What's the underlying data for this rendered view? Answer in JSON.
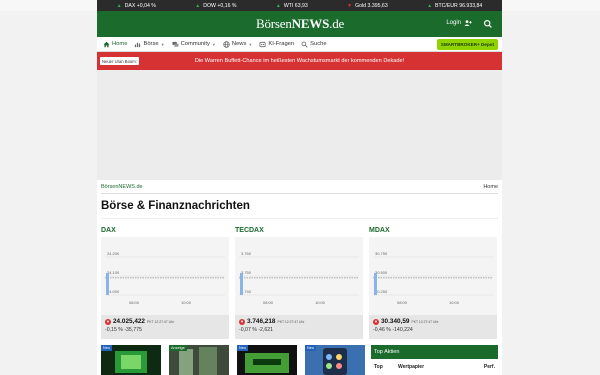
{
  "ticker": [
    {
      "label": "DAX +0,04 %",
      "dir": "up"
    },
    {
      "label": "DOW +0,16 %",
      "dir": "up"
    },
    {
      "label": "WTI 63,93",
      "dir": "up"
    },
    {
      "label": "Gold 3.395,63",
      "dir": "down"
    },
    {
      "label": "BTC/EUR 96.933,84",
      "dir": "up"
    }
  ],
  "header": {
    "logo_a": "Börsen",
    "logo_b": "NEWS",
    "logo_c": ".de",
    "login": "Login"
  },
  "nav": {
    "items": [
      {
        "label": "Home",
        "icon": "home-icon",
        "caret": false
      },
      {
        "label": "Börse",
        "icon": "chart-icon",
        "caret": true
      },
      {
        "label": "Community",
        "icon": "chat-icon",
        "caret": true
      },
      {
        "label": "News",
        "icon": "globe-icon",
        "caret": true
      },
      {
        "label": "KI-Fragen",
        "icon": "ai-icon",
        "caret": false
      },
      {
        "label": "Suche",
        "icon": "search-icon",
        "caret": false
      }
    ],
    "smartbroker": "SMARTBROKER+ Depot"
  },
  "promo": {
    "badge": "Neuer Uran Boom:",
    "text": "Die Warren Buffett-Chance im heißesten Wachstumsmarkt der kommenden Dekade!"
  },
  "breadcrumb": "BörsenNEWS.de",
  "home_link": "Home",
  "page_title": "Börse & Finanznachrichten",
  "indices": [
    {
      "name": "DAX",
      "value": "24.025,422",
      "time": "PKT 12:27:47 Uhr",
      "change": "-0,15 %  -35,775"
    },
    {
      "name": "TECDAX",
      "value": "3.746,218",
      "time": "PKT 12:27:47 Uhr",
      "change": "-0,07 %  -2,621"
    },
    {
      "name": "MDAX",
      "value": "30.340,59",
      "time": "PKT 12:27:47 Uhr",
      "change": "-0,46 %  -140,224"
    }
  ],
  "chart_data": [
    {
      "type": "line",
      "title": "DAX",
      "x_ticks": [
        "08:00",
        "10:00"
      ],
      "y_ticks": [
        24000,
        24100,
        24200
      ]
    },
    {
      "type": "line",
      "title": "TECDAX",
      "x_ticks": [
        "08:00",
        "10:00"
      ],
      "y_ticks": [
        3740,
        3750,
        3760
      ]
    },
    {
      "type": "line",
      "title": "MDAX",
      "x_ticks": [
        "08:00",
        "10:00"
      ],
      "y_ticks": [
        30250,
        30500,
        30750
      ]
    }
  ],
  "news": [
    {
      "badge": "Neu",
      "kind": "neu"
    },
    {
      "badge": "Anzeige",
      "kind": "anz"
    },
    {
      "badge": "Neu",
      "kind": "neu"
    },
    {
      "badge": "Neu",
      "kind": "neu"
    }
  ],
  "top_aktien": {
    "title": "Top Aktien",
    "cols": [
      "Top",
      "Wertpapier",
      "Perf."
    ]
  },
  "colors": {
    "brand": "#1a6b2c",
    "promo": "#d63233",
    "smartbroker": "#8fd400"
  }
}
